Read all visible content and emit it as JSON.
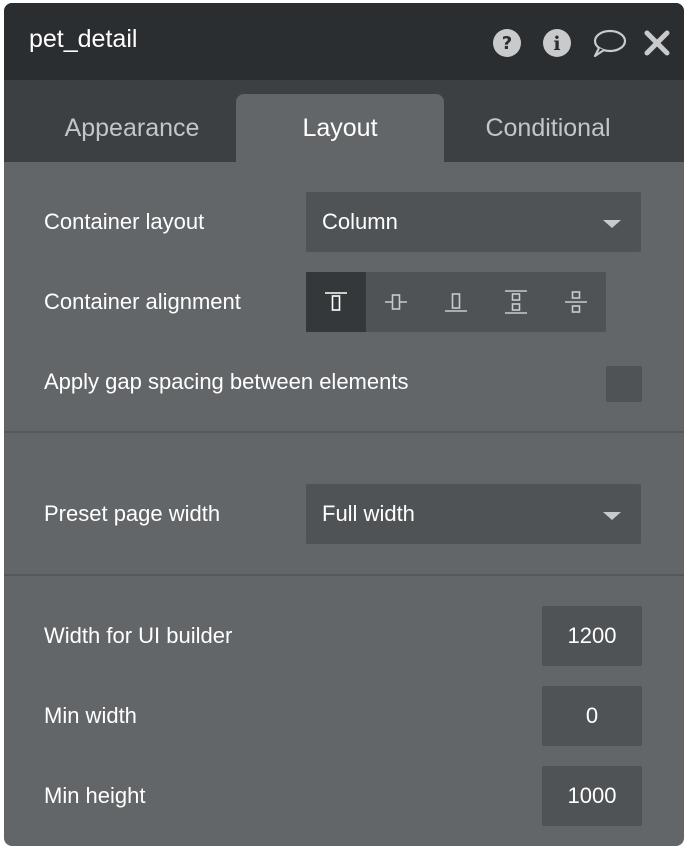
{
  "window": {
    "title": "pet_detail",
    "icons": [
      "help-icon",
      "info-icon",
      "comment-icon",
      "close-icon"
    ]
  },
  "tabs": [
    {
      "label": "Appearance",
      "active": false
    },
    {
      "label": "Layout",
      "active": true
    },
    {
      "label": "Conditional",
      "active": false
    }
  ],
  "layout": {
    "container_layout": {
      "label": "Container layout",
      "value": "Column"
    },
    "container_alignment": {
      "label": "Container alignment",
      "options": [
        "align-top-icon",
        "align-center-icon",
        "align-bottom-icon",
        "space-between-icon",
        "space-around-icon"
      ],
      "selected": 0
    },
    "gap_spacing": {
      "label": "Apply gap spacing between elements",
      "checked": false
    },
    "preset_page_width": {
      "label": "Preset page width",
      "value": "Full width"
    },
    "width_ui_builder": {
      "label": "Width for UI builder",
      "value": "1200"
    },
    "min_width": {
      "label": "Min width",
      "value": "0"
    },
    "min_height": {
      "label": "Min height",
      "value": "1000"
    }
  },
  "colors": {
    "panel": "#626669",
    "titlebar": "#2b2e30",
    "tabbar": "#3c4043",
    "field": "#4f5356",
    "selected_alignment": "#35383a"
  }
}
